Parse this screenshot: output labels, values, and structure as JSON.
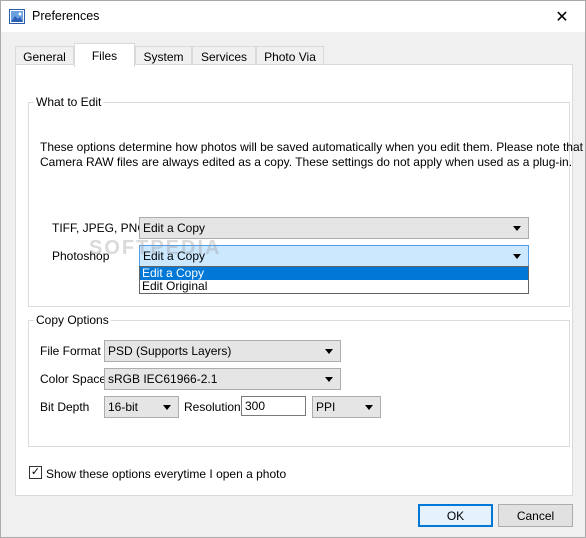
{
  "window": {
    "title": "Preferences",
    "close_glyph": "✕"
  },
  "tabs": [
    {
      "label": "General"
    },
    {
      "label": "Files"
    },
    {
      "label": "System"
    },
    {
      "label": "Services"
    },
    {
      "label": "Photo Via"
    }
  ],
  "active_tab": "Files",
  "what_to_edit": {
    "title": "What to Edit",
    "description_line1": "These options determine how photos will be saved automatically when you edit them.  Please note that",
    "description_line2": "Camera RAW files are always edited as a copy.  These settings do not apply when used as a plug-in.",
    "tiff_label": "TIFF, JPEG, PNG",
    "tiff_value": "Edit a Copy",
    "photoshop_label": "Photoshop",
    "photoshop_value": "Edit a Copy",
    "photoshop_options": [
      "Edit a Copy",
      "Edit Original"
    ],
    "photoshop_selected_option": "Edit a Copy"
  },
  "copy_options": {
    "title": "Copy Options",
    "file_format_label": "File Format",
    "file_format_value": "PSD (Supports Layers)",
    "color_space_label": "Color Space",
    "color_space_value": "sRGB IEC61966-2.1",
    "bit_depth_label": "Bit Depth",
    "bit_depth_value": "16-bit",
    "resolution_label": "Resolution",
    "resolution_value": "300",
    "resolution_unit": "PPI"
  },
  "show_options_checkbox": {
    "label": "Show these options everytime I open a photo",
    "checked": true,
    "check_glyph": "✓"
  },
  "buttons": {
    "ok": "OK",
    "cancel": "Cancel"
  },
  "watermark": "SOFTPEDIA",
  "colors": {
    "accent": "#0078d7",
    "focused_combo": "#cce8ff"
  },
  "icons": [
    "app-icon",
    "close-icon",
    "dropdown-arrow-icon",
    "checkmark-icon"
  ]
}
